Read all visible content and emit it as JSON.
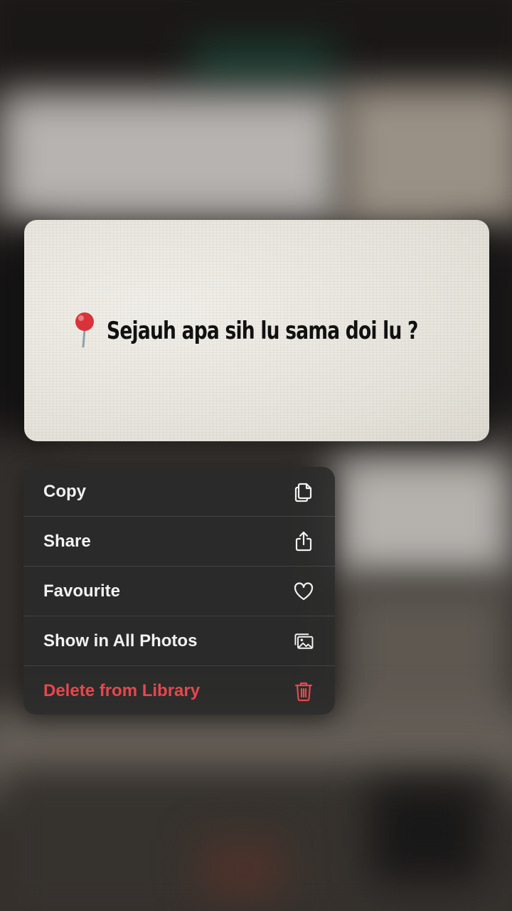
{
  "preview": {
    "caption": "Sejauh apa sih lu sama doi lu ?",
    "pin_icon": "round-pushpin-icon"
  },
  "context_menu": {
    "items": [
      {
        "label": "Copy",
        "icon": "copy-icon",
        "destructive": false
      },
      {
        "label": "Share",
        "icon": "share-icon",
        "destructive": false
      },
      {
        "label": "Favourite",
        "icon": "heart-icon",
        "destructive": false
      },
      {
        "label": "Show in All Photos",
        "icon": "photos-icon",
        "destructive": false
      },
      {
        "label": "Delete from Library",
        "icon": "trash-icon",
        "destructive": true
      }
    ]
  },
  "colors": {
    "menu_text": "#f2f2f2",
    "destructive": "#e5484d",
    "card_paper": "#ebe8e1"
  }
}
